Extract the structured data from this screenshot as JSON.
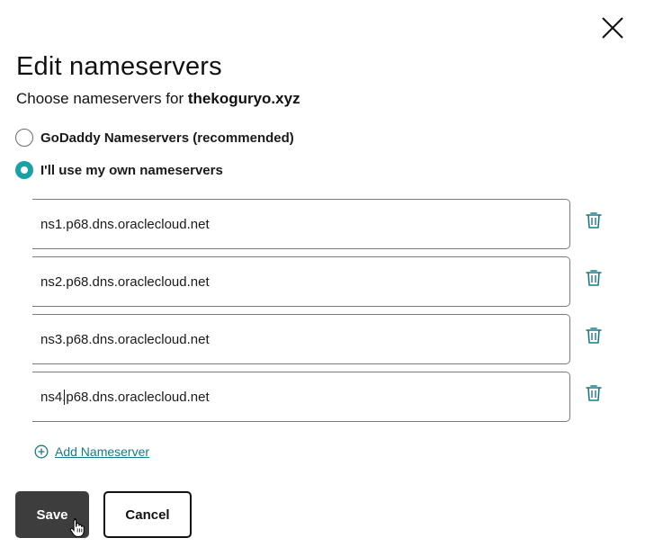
{
  "dialog": {
    "title": "Edit nameservers",
    "subtitle_prefix": "Choose nameservers for ",
    "domain": "thekoguryo.xyz",
    "close_icon": "close-icon"
  },
  "options": {
    "godaddy": {
      "label": "GoDaddy Nameservers (recommended)",
      "selected": false
    },
    "custom": {
      "label": "I'll use my own nameservers",
      "selected": true
    }
  },
  "nameservers": [
    {
      "value": "ns1.p68.dns.oraclecloud.net"
    },
    {
      "value": "ns2.p68.dns.oraclecloud.net"
    },
    {
      "value": "ns3.p68.dns.oraclecloud.net"
    },
    {
      "value": "ns4.p68.dns.oraclecloud.net"
    }
  ],
  "add_nameserver": {
    "label": "Add Nameserver",
    "icon": "plus-circle-icon"
  },
  "actions": {
    "save_label": "Save",
    "cancel_label": "Cancel"
  },
  "colors": {
    "accent": "#1ba0a4",
    "link": "#1a7a82",
    "save_bg": "#3d3d3d"
  }
}
